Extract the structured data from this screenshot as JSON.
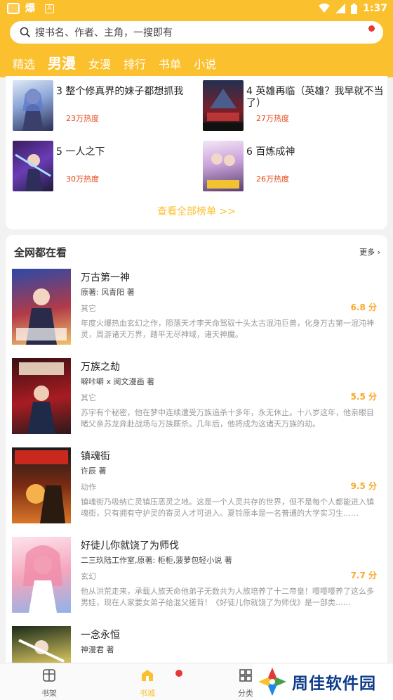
{
  "status_bar": {
    "time": "1:37",
    "app_icon_text": "爆",
    "small_icon_text": "A"
  },
  "search": {
    "placeholder": "搜书名、作者、主角，一搜即有"
  },
  "tabs": [
    {
      "label": "精选"
    },
    {
      "label": "男漫"
    },
    {
      "label": "女漫"
    },
    {
      "label": "排行"
    },
    {
      "label": "书单"
    },
    {
      "label": "小说"
    }
  ],
  "ranking": {
    "items": [
      {
        "rank_title": "3 整个修真界的妹子都想抓我",
        "heat": "23万热度"
      },
      {
        "rank_title": "4 英雄再临（英雄？我早就不当了）",
        "heat": "27万热度"
      },
      {
        "rank_title": "5 一人之下",
        "heat": "30万热度"
      },
      {
        "rank_title": "6 百炼成神",
        "heat": "26万热度"
      }
    ],
    "view_all": "查看全部榜单 >>"
  },
  "all_network": {
    "title": "全网都在看",
    "more": "更多",
    "books": [
      {
        "title": "万古第一神",
        "author": "原著: 风青阳 著",
        "genre": "其它",
        "score": "6.8 分",
        "desc": "年度火爆热血玄幻之作，陨落天才李天命驾驭十头太古混沌巨兽，化身万古第一混沌神灵，周游诸天万界，踏平无尽神域，诸天神魔。"
      },
      {
        "title": "万族之劫",
        "author": "噼咔噼 x 阅文漫画 著",
        "genre": "其它",
        "score": "5.5 分",
        "desc": "苏宇有个秘密，他在梦中连续遭受万族追杀十多年，永无休止。十八岁这年，他亲眼目睹父亲苏龙奔赴战场与万族厮杀。几年后，他将成为这诸天万族的劫。"
      },
      {
        "title": "镇魂街",
        "author": "许辰 著",
        "genre": "动作",
        "score": "9.5 分",
        "desc": "镇魂街乃吸纳亡灵镇压恶灵之地。这是一个人灵共存的世界，但不是每个人都能进入镇魂街，只有拥有守护灵的寄灵人才可进入。夏铃原本是一名普通的大学实习生……"
      },
      {
        "title": "好徒儿你就饶了为师伐",
        "author": "二三玖陆工作室,原著: 柜柜,菠萝包轻小说 著",
        "genre": "玄幻",
        "score": "7.7 分",
        "desc": "他从洪荒走来，承载人族天命他弟子无数共为人族培养了十二帝皇！嘤嘤嘤养了这么多男娃，现在人家要女弟子给混父搓背！《好徒儿你就饶了为师伐》是一部类……"
      },
      {
        "title": "一念永恒",
        "author": "神漫君 著",
        "genre": "",
        "score": "",
        "desc": ""
      }
    ]
  },
  "bottom_nav": [
    {
      "label": "书架",
      "icon": "bookshelf-icon"
    },
    {
      "label": "书城",
      "icon": "bookstore-icon"
    },
    {
      "label": "分类",
      "icon": "category-icon"
    }
  ],
  "watermark": {
    "text": "周佳软件园"
  },
  "colors": {
    "accent": "#fbc02d",
    "heat": "#e64a19",
    "score": "#f9a825",
    "dot": "#e53935"
  }
}
